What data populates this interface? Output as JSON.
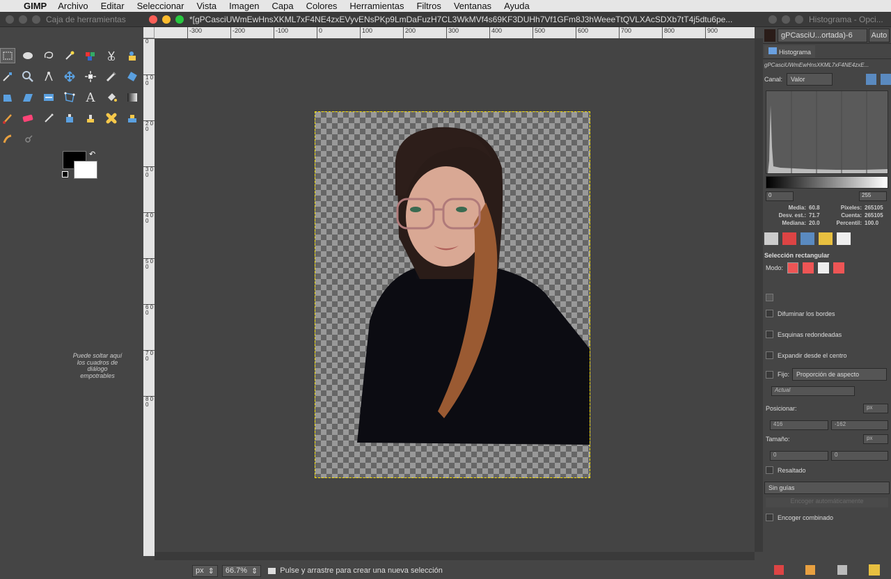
{
  "menubar": {
    "app": "GIMP",
    "items": [
      "Archivo",
      "Editar",
      "Seleccionar",
      "Vista",
      "Imagen",
      "Capa",
      "Colores",
      "Herramientas",
      "Filtros",
      "Ventanas",
      "Ayuda"
    ]
  },
  "toolbox": {
    "title": "Caja de herramientas",
    "drop_note": "Puede soltar aquí los cuadros de diálogo empotrables"
  },
  "image_window": {
    "title": "*[gPCasciUWmEwHnsXKML7xF4NE4zxEVyvENsPKp9LmDaFuzH7CL3WkMVf4s69KF3DUHh7Vf1GFm8J3hWeeeTtQVLXAcSDXb7tT4j5dtu6pe...",
    "hruler_ticks": [
      "-300",
      "-200",
      "-100",
      "0",
      "100",
      "200",
      "300",
      "400",
      "500",
      "600",
      "700",
      "800",
      "900"
    ],
    "vruler_ticks": [
      "0",
      "1 0 0",
      "2 0 0",
      "3 0 0",
      "4 0 0",
      "5 0 0",
      "6 0 0",
      "7 0 0",
      "8 0 0"
    ],
    "status": {
      "unit": "px",
      "zoom": "66.7%",
      "message": "Pulse y arrastre para crear una nueva selección"
    }
  },
  "dock": {
    "window_title": "Histograma - Opci...",
    "image_selector": "gPCasciU...ortada)-6",
    "auto_button": "Auto",
    "histogram": {
      "tab": "Histograma",
      "image_name": "gPCasciUWmEwHnsXKML7xF4NE4zxE...",
      "channel_label": "Canal:",
      "channel_value": "Valor",
      "range_min": "0",
      "range_max": "255",
      "stats": {
        "media_label": "Media:",
        "media": "60.8",
        "desv_label": "Desv. est.:",
        "desv": "71.7",
        "mediana_label": "Mediana:",
        "mediana": "20.0",
        "pixeles_label": "Píxeles:",
        "pixeles": "265105",
        "cuenta_label": "Cuenta:",
        "cuenta": "265105",
        "percentil_label": "Percentil:",
        "percentil": "100.0"
      }
    },
    "tool_options": {
      "title": "Selección rectangular",
      "mode_label": "Modo:",
      "feather": "Difuminar los bordes",
      "rounded": "Esquinas redondeadas",
      "expand": "Expandir desde el centro",
      "fixed_label": "Fijo:",
      "fixed_value": "Proporción de aspecto",
      "actual_placeholder": "Actual",
      "position_label": "Posicionar:",
      "position_unit": "px",
      "pos_x": "416",
      "pos_y": "-162",
      "size_label": "Tamaño:",
      "size_unit": "px",
      "size_w": "0",
      "size_h": "0",
      "highlight": "Resaltado",
      "guides": "Sin guías",
      "autoshrink": "Encoger automáticamente",
      "shrink_merged": "Encoger combinado"
    }
  }
}
